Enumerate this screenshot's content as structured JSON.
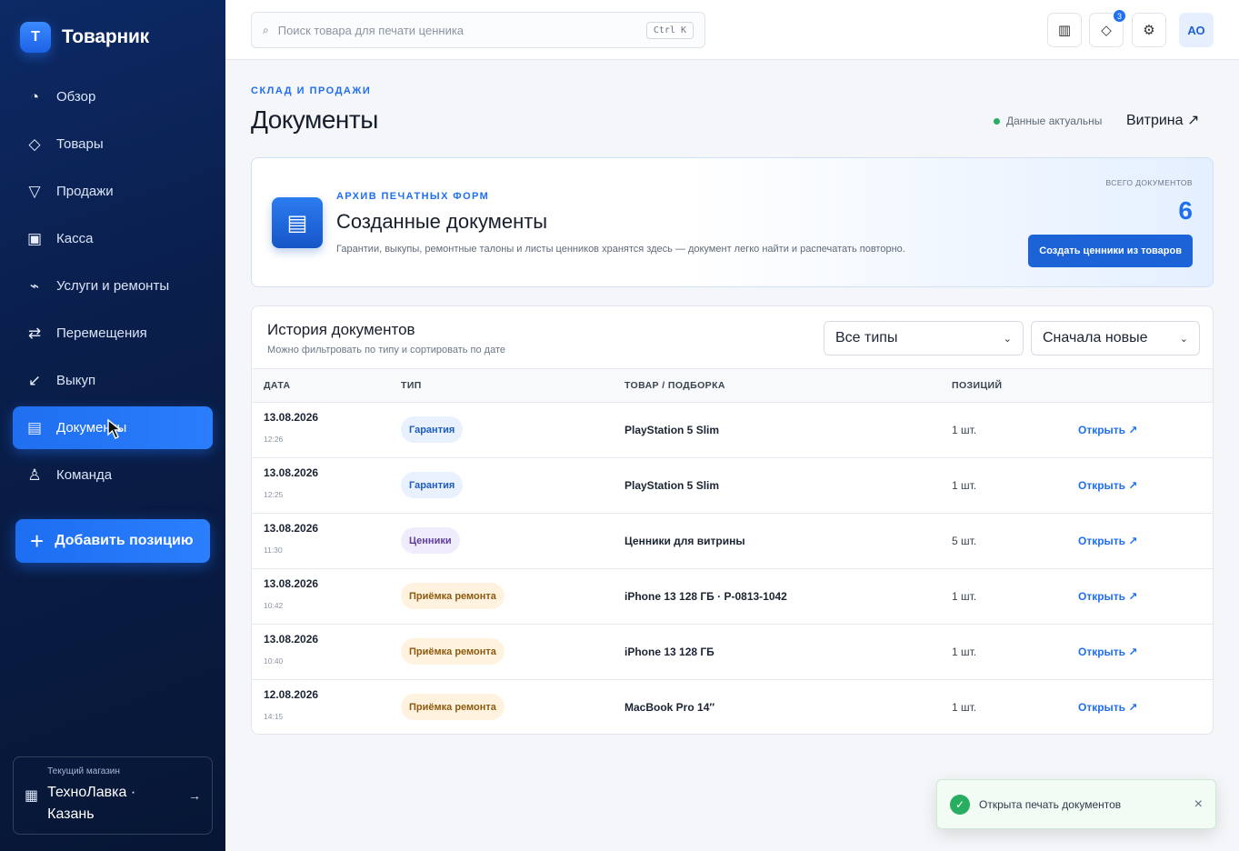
{
  "brand": {
    "logo_letter": "T",
    "name": "Товарник"
  },
  "sidebar": {
    "items": [
      {
        "icon": "◔",
        "icon_name": "dashboard-icon",
        "label": "Обзор"
      },
      {
        "icon": "◇",
        "icon_name": "tag-icon",
        "label": "Товары"
      },
      {
        "icon": "▽",
        "icon_name": "funnel-icon",
        "label": "Продажи"
      },
      {
        "icon": "▣",
        "icon_name": "register-icon",
        "label": "Касса"
      },
      {
        "icon": "⌁",
        "icon_name": "wrench-icon",
        "label": "Услуги и ремонты"
      },
      {
        "icon": "⇄",
        "icon_name": "transfer-icon",
        "label": "Перемещения"
      },
      {
        "icon": "↙",
        "icon_name": "buyback-icon",
        "label": "Выкуп"
      },
      {
        "icon": "▤",
        "icon_name": "document-icon",
        "label": "Документы",
        "active": true
      },
      {
        "icon": "♙",
        "icon_name": "team-icon",
        "label": "Команда"
      }
    ],
    "add_button": {
      "plus": "+",
      "label": "Добавить позицию"
    },
    "store": {
      "caption": "Текущий магазин",
      "name": "ТехноЛавка · Казань",
      "icon": "▦",
      "arrow": "→"
    }
  },
  "topbar": {
    "search": {
      "icon": "⌕",
      "placeholder": "Поиск товара для печати ценника",
      "shortcut": "Ctrl K"
    },
    "buttons": [
      {
        "icon": "▥",
        "icon_name": "barcode-icon"
      },
      {
        "icon": "◇",
        "icon_name": "notifications-icon",
        "badge": "3"
      },
      {
        "icon": "⚙",
        "icon_name": "gear-icon"
      }
    ],
    "avatar": "АО"
  },
  "page": {
    "eyebrow": "СКЛАД И ПРОДАЖИ",
    "title": "Документы",
    "status": "Данные актуальны",
    "vitrina": "Витрина ↗"
  },
  "hero": {
    "icon": "▤",
    "eyebrow": "АРХИВ ПЕЧАТНЫХ ФОРМ",
    "title": "Созданные документы",
    "description": "Гарантии, выкупы, ремонтные талоны и листы ценников хранятся здесь — документ легко найти и распечатать повторно.",
    "total_caption": "ВСЕГО ДОКУМЕНТОВ",
    "total": "6",
    "button": "Создать ценники из товаров"
  },
  "history": {
    "title": "История документов",
    "subtitle": "Можно фильтровать по типу и сортировать по дате",
    "type_filter": "Все типы",
    "sort": "Сначала новые",
    "columns": [
      "ДАТА",
      "ТИП",
      "ТОВАР / ПОДБОРКА",
      "ПОЗИЦИЙ"
    ],
    "rows": [
      {
        "date": "13.08.2026",
        "time": "12:26",
        "type": "Гарантия",
        "type_color": "blue",
        "item": "PlayStation 5 Slim",
        "qty": "1 шт.",
        "action": "Открыть ↗"
      },
      {
        "date": "13.08.2026",
        "time": "12:25",
        "type": "Гарантия",
        "type_color": "blue",
        "item": "PlayStation 5 Slim",
        "qty": "1 шт.",
        "action": "Открыть ↗"
      },
      {
        "date": "13.08.2026",
        "time": "11:30",
        "type": "Ценники",
        "type_color": "purple",
        "item": "Ценники для витрины",
        "qty": "5 шт.",
        "action": "Открыть ↗"
      },
      {
        "date": "13.08.2026",
        "time": "10:42",
        "type": "Приёмка ремонта",
        "type_color": "orange",
        "item": "iPhone 13 128 ГБ · P-0813-1042",
        "qty": "1 шт.",
        "action": "Открыть ↗"
      },
      {
        "date": "13.08.2026",
        "time": "10:40",
        "type": "Приёмка ремонта",
        "type_color": "orange",
        "item": "iPhone 13 128 ГБ",
        "qty": "1 шт.",
        "action": "Открыть ↗"
      },
      {
        "date": "12.08.2026",
        "time": "14:15",
        "type": "Приёмка ремонта",
        "type_color": "orange",
        "item": "MacBook Pro 14″",
        "qty": "1 шт.",
        "action": "Открыть ↗"
      }
    ]
  },
  "toast": {
    "icon": "✓",
    "message": "Открыта печать документов",
    "close": "×"
  }
}
